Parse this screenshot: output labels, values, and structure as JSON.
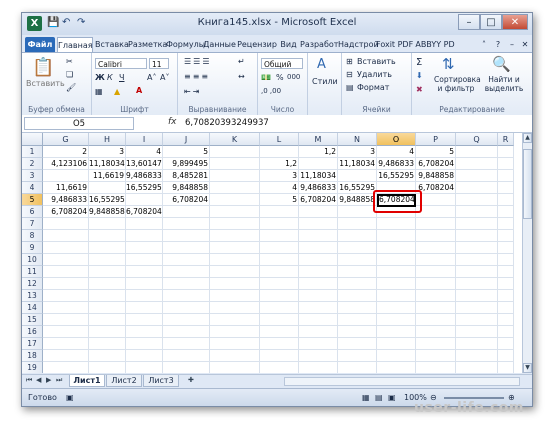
{
  "window": {
    "title": "Книга145.xlsx - Microsoft Excel",
    "logo": "X"
  },
  "qat": {
    "save_icon": "save-icon",
    "undo_icon": "undo-icon",
    "redo_icon": "redo-icon"
  },
  "tabs": [
    "Файл",
    "Главная",
    "Вставка",
    "Разметка",
    "Формулы",
    "Данные",
    "Рецензир",
    "Вид",
    "Разработ",
    "Надстрой",
    "Foxit PDF",
    "ABBYY PD"
  ],
  "ribbon": {
    "paste": "Вставить",
    "clipboard": "Буфер обмена",
    "font_name": "Calibri",
    "font_size": "11",
    "bold": "Ж",
    "italic": "К",
    "underline": "Ч",
    "grow": "A˄",
    "shrink": "A˅",
    "font": "Шрифт",
    "alignment": "Выравнивание",
    "number_format": "Общий",
    "percent": "%",
    "thousands": "000",
    "number": "Число",
    "styles": "Стили",
    "insert": "Вставить",
    "delete": "Удалить",
    "format": "Формат",
    "cells": "Ячейки",
    "sigma": "Σ",
    "sort": "Сортировка и фильтр",
    "find": "Найти и выделить",
    "editing": "Редактирование"
  },
  "formula_bar": {
    "name_box": "O5",
    "fx": "fx",
    "value": "6,70820393249937"
  },
  "columns": [
    "G",
    "H",
    "I",
    "J",
    "K",
    "L",
    "M",
    "N",
    "O",
    "P",
    "Q",
    "R"
  ],
  "rows": [
    {
      "n": "1",
      "cells": {
        "G": "2",
        "H": "3",
        "I": "4",
        "J": "5",
        "M": "1,2",
        "N": "3",
        "O": "4",
        "P": "5"
      }
    },
    {
      "n": "2",
      "cells": {
        "G": "4,123106",
        "H": "11,18034",
        "I": "13,60147",
        "J": "9,899495",
        "L": "1,2",
        "N": "11,18034",
        "O": "9,486833",
        "P": "6,708204"
      }
    },
    {
      "n": "3",
      "cells": {
        "H": "11,6619",
        "I": "9,486833",
        "J": "8,485281",
        "L": "3",
        "M": "11,18034",
        "O": "16,55295",
        "P": "9,848858"
      }
    },
    {
      "n": "4",
      "cells": {
        "G": "11,6619",
        "I": "16,55295",
        "J": "9,848858",
        "L": "4",
        "M": "9,486833",
        "N": "16,55295",
        "P": "6,708204"
      }
    },
    {
      "n": "5",
      "cells": {
        "G": "9,486833",
        "H": "16,55295",
        "J": "6,708204",
        "L": "5",
        "M": "6,708204",
        "N": "9,848858",
        "O": "6,708204"
      }
    },
    {
      "n": "6",
      "cells": {
        "G": "6,708204",
        "H": "9,848858",
        "I": "6,708204"
      }
    },
    {
      "n": "7",
      "cells": {}
    },
    {
      "n": "8",
      "cells": {}
    },
    {
      "n": "9",
      "cells": {}
    },
    {
      "n": "10",
      "cells": {}
    },
    {
      "n": "11",
      "cells": {}
    },
    {
      "n": "12",
      "cells": {}
    },
    {
      "n": "13",
      "cells": {}
    },
    {
      "n": "14",
      "cells": {}
    },
    {
      "n": "15",
      "cells": {}
    },
    {
      "n": "16",
      "cells": {}
    },
    {
      "n": "17",
      "cells": {}
    },
    {
      "n": "18",
      "cells": {}
    },
    {
      "n": "19",
      "cells": {}
    }
  ],
  "active_cell": {
    "col": "O",
    "row": "5"
  },
  "sheets": [
    "Лист1",
    "Лист2",
    "Лист3"
  ],
  "active_sheet": "Лист1",
  "status": "Готово",
  "zoom": "100%",
  "watermark": "user-life.com",
  "colors": {
    "accent": "#2a6ab9",
    "highlight": "#e10000",
    "selected_header": "#f1c15f"
  }
}
